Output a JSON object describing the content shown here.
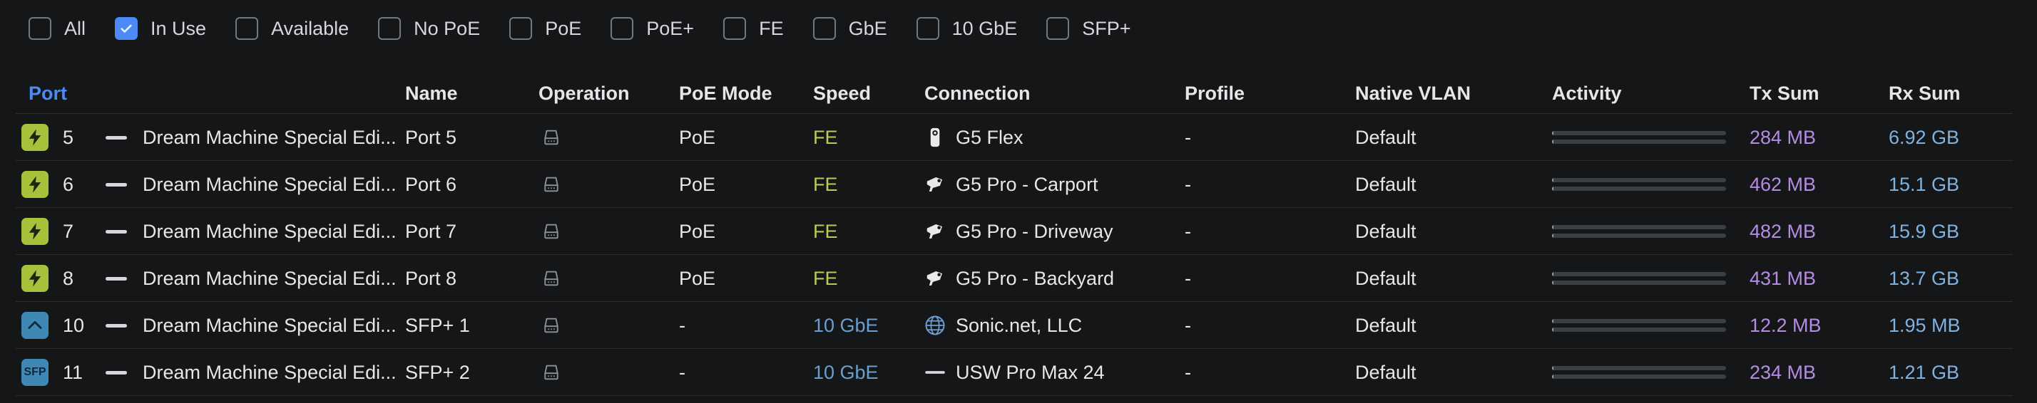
{
  "filters": [
    {
      "label": "All",
      "checked": false
    },
    {
      "label": "In Use",
      "checked": true
    },
    {
      "label": "Available",
      "checked": false
    },
    {
      "label": "No PoE",
      "checked": false
    },
    {
      "label": "PoE",
      "checked": false
    },
    {
      "label": "PoE+",
      "checked": false
    },
    {
      "label": "FE",
      "checked": false
    },
    {
      "label": "GbE",
      "checked": false
    },
    {
      "label": "10 GbE",
      "checked": false
    },
    {
      "label": "SFP+",
      "checked": false
    }
  ],
  "table": {
    "sorted_column": "Port",
    "columns": {
      "port": "Port",
      "name": "Name",
      "operation": "Operation",
      "poe_mode": "PoE Mode",
      "speed": "Speed",
      "connection": "Connection",
      "profile": "Profile",
      "native_vlan": "Native VLAN",
      "activity": "Activity",
      "tx_sum": "Tx Sum",
      "rx_sum": "Rx Sum"
    },
    "rows": [
      {
        "port_icon": "lightning-icon",
        "port": "5",
        "device": "Dream Machine Special Edi...",
        "name": "Port 5",
        "operation_icon": "switching-icon",
        "poe_mode": "PoE",
        "speed": "FE",
        "conn_icon": "camera-flex-icon",
        "connection": "G5 Flex",
        "profile": "-",
        "native_vlan": "Default",
        "activity": [
          0.0,
          0.0
        ],
        "tx": "284 MB",
        "rx": "6.92 GB"
      },
      {
        "port_icon": "lightning-icon",
        "port": "6",
        "device": "Dream Machine Special Edi...",
        "name": "Port 6",
        "operation_icon": "switching-icon",
        "poe_mode": "PoE",
        "speed": "FE",
        "conn_icon": "camera-bullet-icon",
        "connection": "G5 Pro - Carport",
        "profile": "-",
        "native_vlan": "Default",
        "activity": [
          0.0,
          0.0
        ],
        "tx": "462 MB",
        "rx": "15.1 GB"
      },
      {
        "port_icon": "lightning-icon",
        "port": "7",
        "device": "Dream Machine Special Edi...",
        "name": "Port 7",
        "operation_icon": "switching-icon",
        "poe_mode": "PoE",
        "speed": "FE",
        "conn_icon": "camera-bullet-icon",
        "connection": "G5 Pro - Driveway",
        "profile": "-",
        "native_vlan": "Default",
        "activity": [
          0.0,
          0.0
        ],
        "tx": "482 MB",
        "rx": "15.9 GB"
      },
      {
        "port_icon": "lightning-icon",
        "port": "8",
        "device": "Dream Machine Special Edi...",
        "name": "Port 8",
        "operation_icon": "switching-icon",
        "poe_mode": "PoE",
        "speed": "FE",
        "conn_icon": "camera-bullet-icon",
        "connection": "G5 Pro - Backyard",
        "profile": "-",
        "native_vlan": "Default",
        "activity": [
          0.0,
          0.0
        ],
        "tx": "431 MB",
        "rx": "13.7 GB"
      },
      {
        "port_icon": "wan-uplink-icon",
        "port": "10",
        "device": "Dream Machine Special Edi...",
        "name": "SFP+ 1",
        "operation_icon": "switching-icon",
        "poe_mode": "-",
        "speed": "10 GbE",
        "conn_icon": "globe-icon",
        "connection": "Sonic.net, LLC",
        "profile": "-",
        "native_vlan": "Default",
        "activity": [
          0.01,
          0.01
        ],
        "tx": "12.2 MB",
        "rx": "1.95 MB"
      },
      {
        "port_icon": "sfp-icon",
        "port_icon_text": "SFP",
        "port": "11",
        "device": "Dream Machine Special Edi...",
        "name": "SFP+ 2",
        "operation_icon": "switching-icon",
        "poe_mode": "-",
        "speed": "10 GbE",
        "conn_icon": "switch-device-icon",
        "connection": "USW Pro Max 24",
        "profile": "-",
        "native_vlan": "Default",
        "activity": [
          0.01,
          0.01
        ],
        "tx": "234 MB",
        "rx": "1.21 GB"
      }
    ]
  }
}
